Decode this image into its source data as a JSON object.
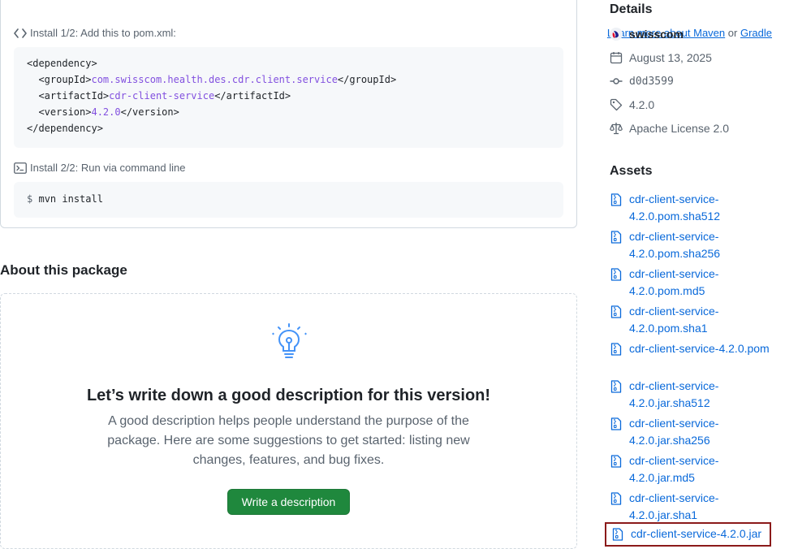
{
  "install": {
    "step1_label": "Install 1/2: Add this to pom.xml:",
    "learn_more_link": "Learn more about Maven",
    "or_text": "or",
    "gradle_link": "Gradle",
    "code_lines": {
      "l1": "<dependency>",
      "l2_open": "  <groupId>",
      "l2_val": "com.swisscom.health.des.cdr.client.service",
      "l2_close": "</groupId>",
      "l3_open": "  <artifactId>",
      "l3_val": "cdr-client-service",
      "l3_close": "</artifactId>",
      "l4_open": "  <version>",
      "l4_val": "4.2.0",
      "l4_close": "</version>",
      "l5": "</dependency>"
    },
    "step2_label": "Install 2/2: Run via command line",
    "cmd_prompt": "$",
    "cmd": "mvn install"
  },
  "about": {
    "title": "About this package",
    "blank_title": "Let’s write down a good description for this version!",
    "blank_desc": "A good description helps people understand the purpose of the package. Here are some suggestions to get started: listing new changes, features, and bug fixes.",
    "button": "Write a description"
  },
  "details": {
    "title": "Details",
    "owner": "swisscom",
    "date": "August 13, 2025",
    "commit": "d0d3599",
    "version": "4.2.0",
    "license": "Apache License 2.0"
  },
  "assets": {
    "title": "Assets",
    "items": [
      "cdr-client-service-4.2.0.pom.sha512",
      "cdr-client-service-4.2.0.pom.sha256",
      "cdr-client-service-4.2.0.pom.md5",
      "cdr-client-service-4.2.0.pom.sha1",
      "cdr-client-service-4.2.0.pom",
      "cdr-client-service-4.2.0.jar.sha512",
      "cdr-client-service-4.2.0.jar.sha256",
      "cdr-client-service-4.2.0.jar.md5",
      "cdr-client-service-4.2.0.jar.sha1",
      "cdr-client-service-4.2.0.jar"
    ]
  },
  "icons": {
    "code": "code-icon",
    "terminal": "terminal-icon",
    "lightbulb": "lightbulb-icon",
    "calendar": "calendar-icon",
    "commit": "git-commit-icon",
    "tag": "tag-icon",
    "law": "law-icon",
    "file_zip": "file-zip-icon"
  },
  "colors": {
    "link": "#0969da",
    "primary_button": "#1f883d",
    "code_value": "#8250df",
    "selection_border": "#8b1a1a"
  }
}
